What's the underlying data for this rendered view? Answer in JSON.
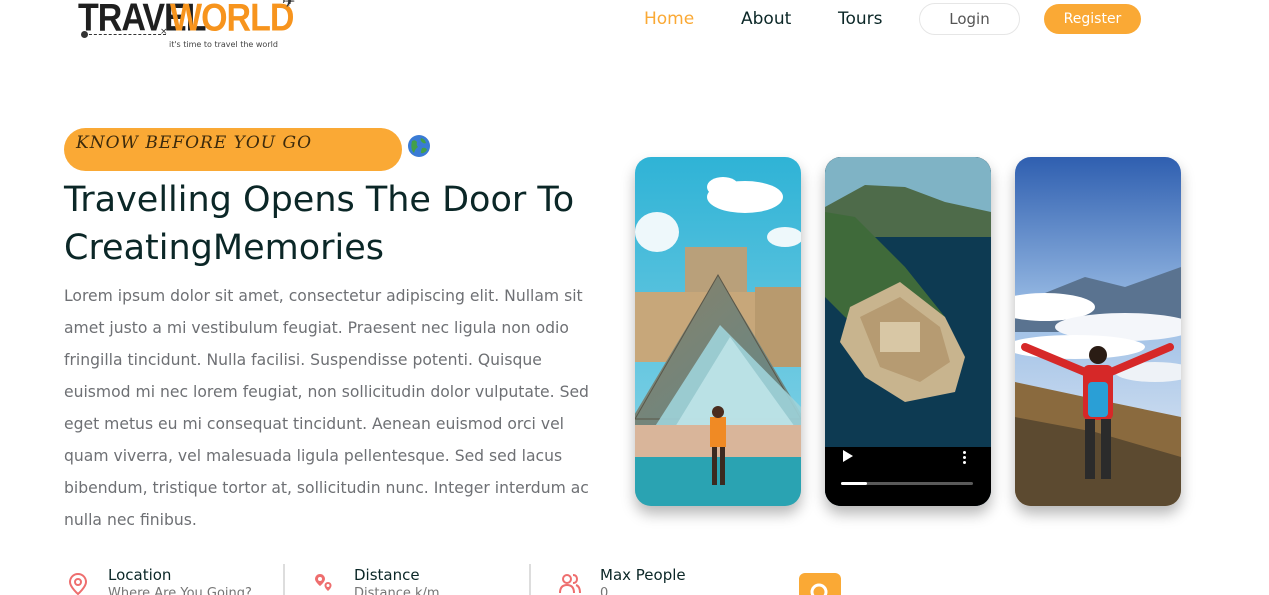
{
  "logo": {
    "part1": "TRAVEL",
    "part2": "WORLD",
    "tagline": "it's time to travel the world"
  },
  "nav": {
    "items": [
      {
        "label": "Home",
        "active": true
      },
      {
        "label": "About",
        "active": false
      },
      {
        "label": "Tours",
        "active": false
      }
    ],
    "login_label": "Login",
    "register_label": "Register"
  },
  "hero": {
    "subtitle": "Know Before You Go",
    "title": "Travelling Opens The Door To CreatingMemories",
    "description": "Lorem ipsum dolor sit amet, consectetur adipiscing elit. Nullam sit amet justo a mi vestibulum feugiat. Praesent nec ligula non odio fringilla tincidunt. Nulla facilisi. Suspendisse potenti. Quisque euismod mi nec lorem feugiat, non sollicitudin dolor vulputate. Sed eget metus eu mi consequat tincidunt. Aenean euismod orci vel quam viverra, vel malesuada ligula pellentesque. Sed sed lacus bibendum, tristique tortor at, sollicitudin nunc. Integer interdum ac nulla nec finibus."
  },
  "media": {
    "video_progress": 0.2
  },
  "search": {
    "fields": [
      {
        "label": "Location",
        "placeholder": "Where Are You Going?",
        "icon": "map-pin-icon"
      },
      {
        "label": "Distance",
        "placeholder": "Distance k/m",
        "icon": "route-pin-icon"
      },
      {
        "label": "Max People",
        "placeholder": "0",
        "icon": "people-icon"
      }
    ]
  },
  "colors": {
    "accent": "#faa935",
    "heading": "#0b2727",
    "text": "#6e7074",
    "icon": "#ee6e6e"
  }
}
